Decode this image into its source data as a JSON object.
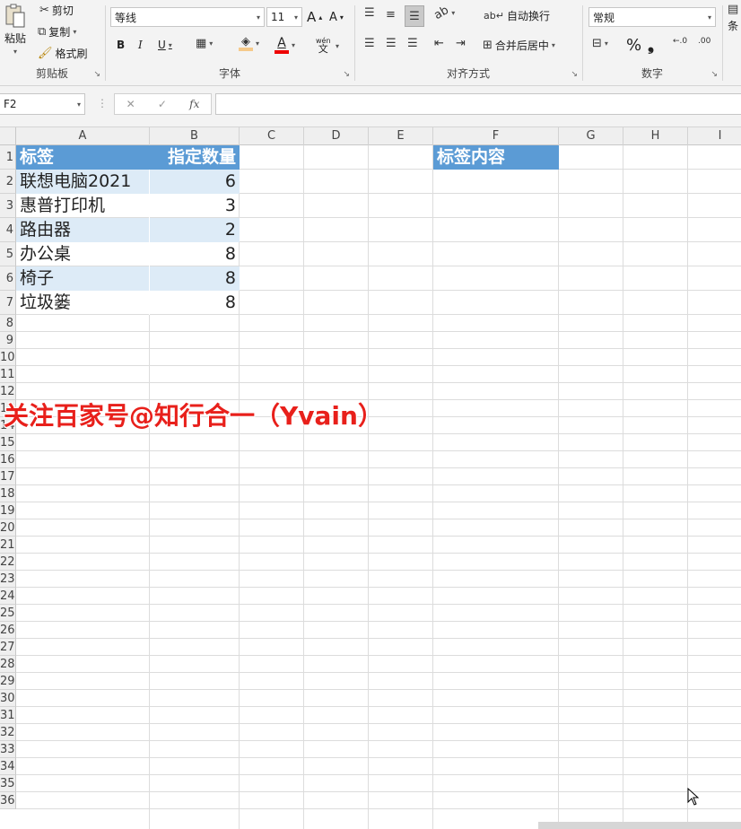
{
  "ribbon": {
    "clipboard": {
      "paste": "粘贴",
      "cut": "剪切",
      "copy": "复制",
      "format_painter": "格式刷",
      "caption": "剪贴板"
    },
    "font": {
      "name": "等线",
      "size": "11",
      "bold": "B",
      "italic": "I",
      "underline": "U",
      "font_color_glyph": "A",
      "phonetic_glyph": "wén",
      "grow": "A",
      "shrink": "A",
      "caption": "字体"
    },
    "alignment": {
      "wrap_text": "自动换行",
      "merge_center": "合并后居中",
      "caption": "对齐方式"
    },
    "number": {
      "format": "常规",
      "percent": "%",
      "comma": "❟",
      "caption": "数字"
    },
    "next_group_partial": "条"
  },
  "formula_bar": {
    "name_box": "F2",
    "fx": "fx",
    "content": ""
  },
  "columns": [
    "A",
    "B",
    "C",
    "D",
    "E",
    "F",
    "G",
    "H",
    "I"
  ],
  "rows": [
    "1",
    "2",
    "3",
    "4",
    "5",
    "6",
    "7",
    "8",
    "9",
    "10",
    "11",
    "12",
    "13",
    "14",
    "15",
    "16",
    "17",
    "18",
    "19",
    "20",
    "21",
    "22",
    "23",
    "24",
    "25",
    "26",
    "27",
    "28",
    "29",
    "30",
    "31",
    "32",
    "33",
    "34",
    "35",
    "36"
  ],
  "table": {
    "headers": [
      "标签",
      "指定数量"
    ],
    "rows": [
      {
        "label": "联想电脑2021",
        "qty": "6"
      },
      {
        "label": "惠普打印机",
        "qty": "3"
      },
      {
        "label": "路由器",
        "qty": "2"
      },
      {
        "label": "办公桌",
        "qty": "8"
      },
      {
        "label": "椅子",
        "qty": "8"
      },
      {
        "label": "垃圾篓",
        "qty": "8"
      }
    ]
  },
  "f_header": "标签内容",
  "watermark": "关注百家号@知行合一（Yvain）",
  "colors": {
    "header_fill": "#5b9bd5",
    "band_fill": "#ddebf7",
    "watermark": "#e8201b"
  }
}
